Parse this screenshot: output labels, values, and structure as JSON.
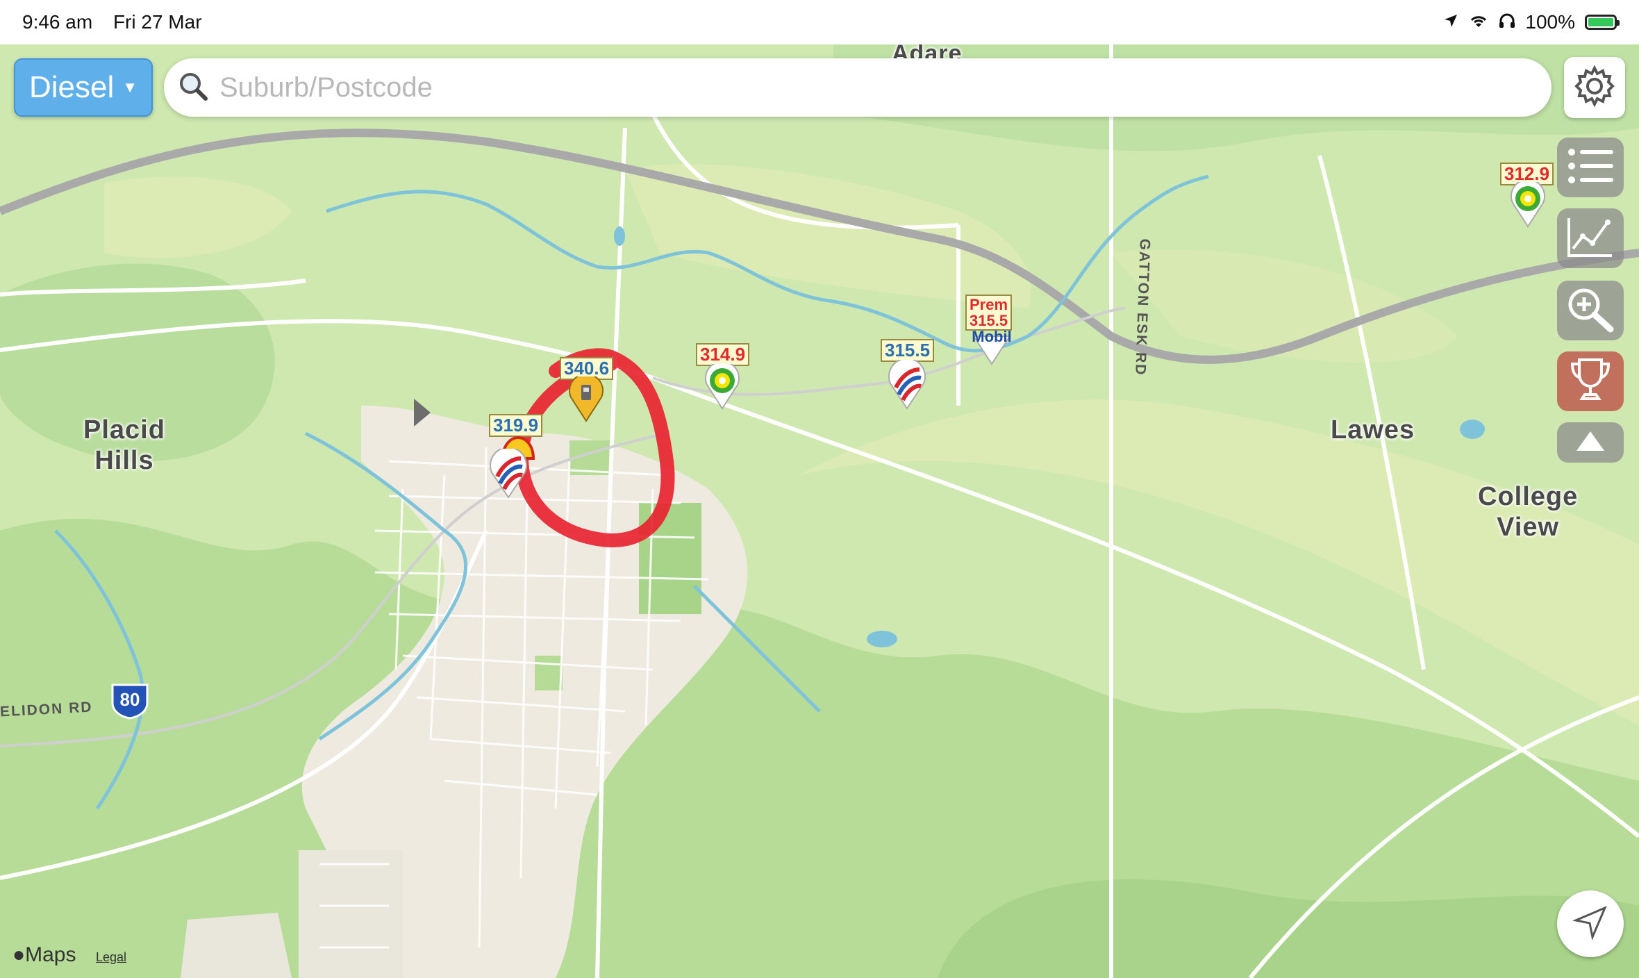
{
  "status_bar": {
    "time": "9:46 am",
    "date": "Fri 27 Mar",
    "battery": "100%"
  },
  "controls": {
    "fuel_type": "Diesel",
    "search_placeholder": "Suburb/Postcode"
  },
  "places": {
    "placid_hills_line1": "Placid",
    "placid_hills_line2": "Hills",
    "lawes": "Lawes",
    "college_view_line1": "College",
    "college_view_line2": "View",
    "adare": "Adare"
  },
  "roads": {
    "gatton_esk": "GATTON ESK RD",
    "helidon": "ELIDON RD",
    "highway_shield": "80"
  },
  "stations": [
    {
      "price": "340.6",
      "brand": "unbranded-icon",
      "color": "blue"
    },
    {
      "price": "319.9",
      "brand": "shell-icon",
      "color": "blue"
    },
    {
      "price": "314.9",
      "brand": "bp-icon",
      "color": "red"
    },
    {
      "price": "315.5",
      "brand": "puma-icon",
      "color": "blue"
    },
    {
      "price_label": "Prem",
      "price": "315.5",
      "brand": "Mobil",
      "color": "red"
    },
    {
      "price": "312.9",
      "brand": "bp-icon",
      "color": "red"
    }
  ],
  "footer": {
    "maps_label": "Maps",
    "legal_label": "Legal"
  },
  "colors": {
    "fuel_button": "#5fb0ea",
    "price_blue": "#2a6fb0",
    "price_red": "#e02b2b",
    "annotation_circle": "#e8202e",
    "trophy_button": "#be5a50"
  }
}
